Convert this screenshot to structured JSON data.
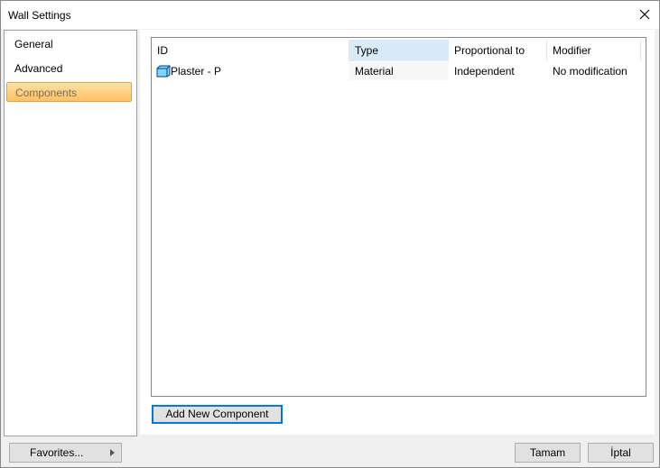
{
  "window": {
    "title": "Wall Settings"
  },
  "sidebar": {
    "items": [
      {
        "label": "General",
        "active": false
      },
      {
        "label": "Advanced",
        "active": false
      },
      {
        "label": "Components",
        "active": true
      }
    ]
  },
  "components_list": {
    "columns": [
      "ID",
      "Type",
      "Proportional to",
      "Modifier"
    ],
    "sorted_column": "Type",
    "rows": [
      {
        "icon": "cube-icon",
        "id": "Plaster - P",
        "type": "Material",
        "proportional_to": "Independent",
        "modifier": "No modification"
      }
    ]
  },
  "buttons": {
    "add_component": "Add New Component",
    "favorites": "Favorites...",
    "ok": "Tamam",
    "cancel": "İptal"
  },
  "colors": {
    "active_nav_bg": "#ffcf7e",
    "active_nav_border": "#e8a04a",
    "sorted_header_bg": "#d9ebf9",
    "focus_border": "#0078d7"
  }
}
